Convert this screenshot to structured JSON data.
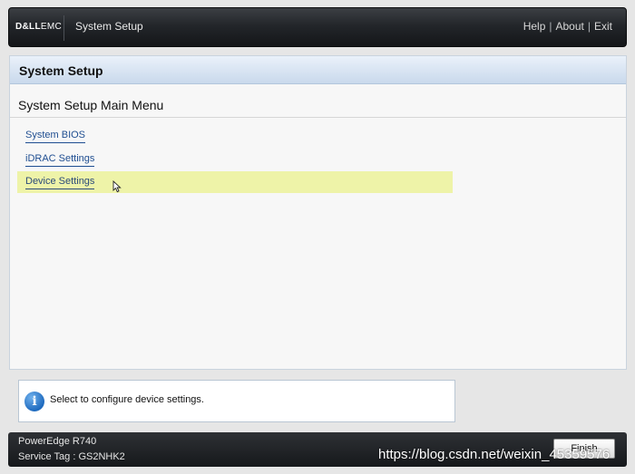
{
  "header": {
    "logo_dell": "D&LL",
    "logo_emc": "EMC",
    "app_title": "System Setup",
    "links": [
      "Help",
      "About",
      "Exit"
    ]
  },
  "main": {
    "section_title": "System Setup",
    "menu_title": "System Setup Main Menu",
    "menu_items": [
      {
        "label": "System BIOS"
      },
      {
        "label": "iDRAC Settings"
      },
      {
        "label": "Device Settings",
        "selected": true
      }
    ]
  },
  "help": {
    "icon": "info-icon",
    "text": "Select to configure device settings."
  },
  "footer": {
    "model": "PowerEdge R740",
    "service_tag": "Service Tag : GS2NHK2",
    "finish_label": "Finish"
  },
  "watermark": "https://blog.csdn.net/weixin_45359576",
  "colors": {
    "link": "#1f4e91",
    "selected_row": "#eef3a8",
    "header_band": "#c9d9ec",
    "topbar": "#23262a"
  }
}
